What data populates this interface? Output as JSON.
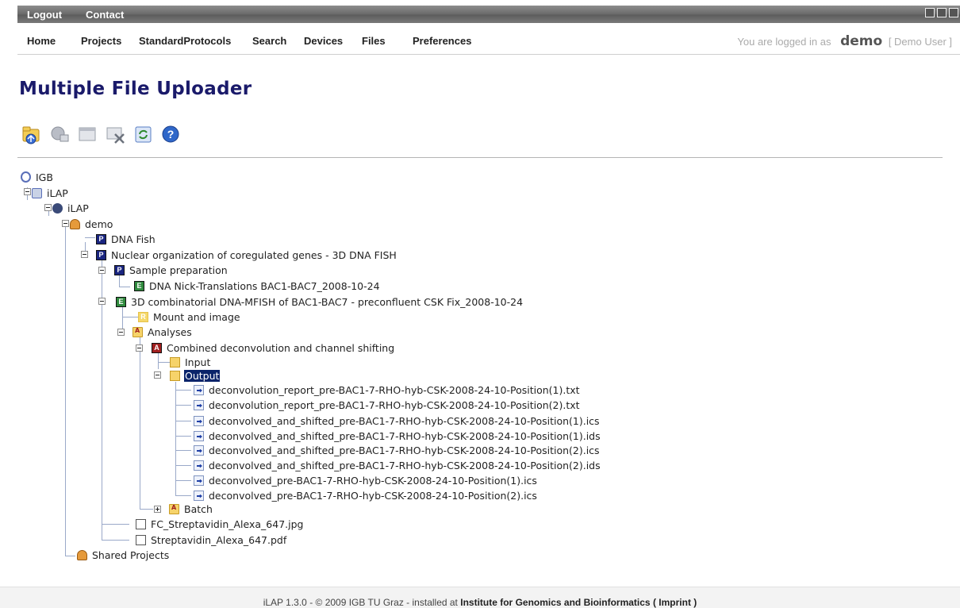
{
  "topbar": {
    "logout": "Logout",
    "contact": "Contact"
  },
  "nav": {
    "home": "Home",
    "projects": "Projects",
    "protocols": "StandardProtocols",
    "search": "Search",
    "devices": "Devices",
    "files": "Files",
    "preferences": "Preferences"
  },
  "login": {
    "prefix": "You are logged in as",
    "username": "demo",
    "display": "[ Demo User ]"
  },
  "page_title": "Multiple File Uploader",
  "toolbar": {
    "icons": [
      "upload-folder-icon",
      "network-icon",
      "window-icon",
      "delete-icon",
      "refresh-icon",
      "help-icon"
    ]
  },
  "tree": {
    "igb": "IGB",
    "ilap_root": "iLAP",
    "ilap_inst": "iLAP",
    "user": "demo",
    "proj1": "DNA Fish",
    "proj2": "Nuclear organization of coregulated genes - 3D DNA FISH",
    "sample_prep": "Sample preparation",
    "exp1": "DNA Nick-Translations BAC1-BAC7_2008-10-24",
    "exp2": "3D combinatorial DNA-MFISH of BAC1-BAC7 - preconfluent CSK Fix_2008-10-24",
    "mount": "Mount and image",
    "analyses": "Analyses",
    "combined": "Combined deconvolution and channel shifting",
    "input": "Input",
    "output": "Output",
    "files": [
      "deconvolution_report_pre-BAC1-7-RHO-hyb-CSK-2008-24-10-Position(1).txt",
      "deconvolution_report_pre-BAC1-7-RHO-hyb-CSK-2008-24-10-Position(2).txt",
      "deconvolved_and_shifted_pre-BAC1-7-RHO-hyb-CSK-2008-24-10-Position(1).ics",
      "deconvolved_and_shifted_pre-BAC1-7-RHO-hyb-CSK-2008-24-10-Position(1).ids",
      "deconvolved_and_shifted_pre-BAC1-7-RHO-hyb-CSK-2008-24-10-Position(2).ics",
      "deconvolved_and_shifted_pre-BAC1-7-RHO-hyb-CSK-2008-24-10-Position(2).ids",
      "deconvolved_pre-BAC1-7-RHO-hyb-CSK-2008-24-10-Position(1).ics",
      "deconvolved_pre-BAC1-7-RHO-hyb-CSK-2008-24-10-Position(2).ics"
    ],
    "batch": "Batch",
    "img_file": "FC_Streptavidin_Alexa_647.jpg",
    "pdf_file": "Streptavidin_Alexa_647.pdf",
    "shared": "Shared Projects"
  },
  "footer": {
    "version": "iLAP 1.3.0 - © 2009 IGB TU Graz - installed at",
    "institute": "Institute for Genomics and Bioinformatics",
    "imprint": "( Imprint )"
  },
  "colors": {
    "title": "#1a1a6a",
    "selection": "#0a246a",
    "project_badge": "#1a2580",
    "experiment_badge": "#2f8a3d",
    "analysis_badge": "#a11f1f"
  }
}
